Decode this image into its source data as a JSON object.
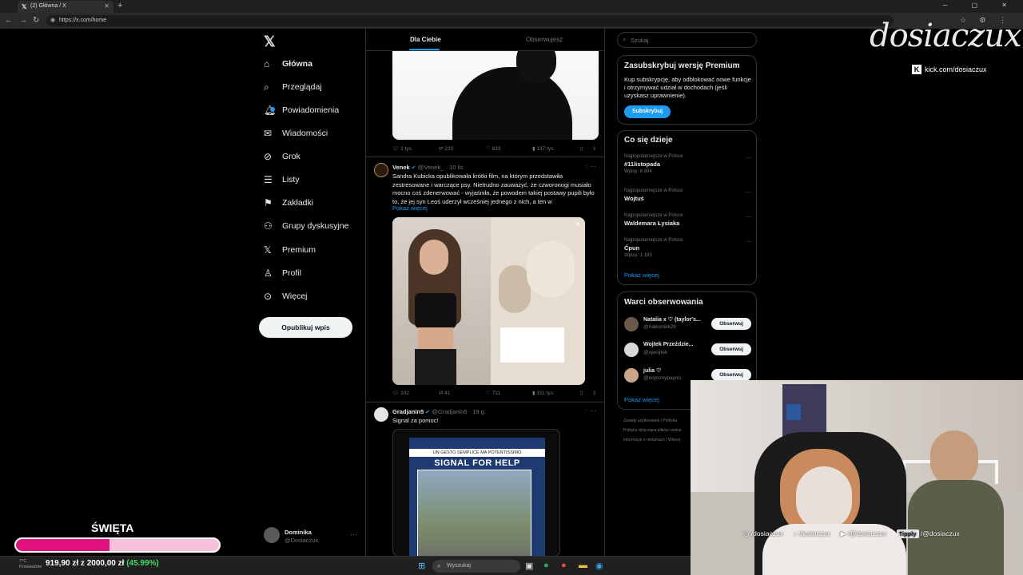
{
  "browser": {
    "tab_title": "(2) Główna / X",
    "tab_icon": "x-logo-icon",
    "url": "https://x.com/home"
  },
  "nav": {
    "items": [
      {
        "label": "Główna",
        "icon": "home-icon",
        "active": true
      },
      {
        "label": "Przeglądaj",
        "icon": "search-icon"
      },
      {
        "label": "Powiadomienia",
        "icon": "bell-icon"
      },
      {
        "label": "Wiadomości",
        "icon": "mail-icon"
      },
      {
        "label": "Grok",
        "icon": "grok-icon"
      },
      {
        "label": "Listy",
        "icon": "list-icon"
      },
      {
        "label": "Zakładki",
        "icon": "bookmark-icon"
      },
      {
        "label": "Grupy dyskusyjne",
        "icon": "communities-icon"
      },
      {
        "label": "Premium",
        "icon": "x-logo-icon"
      },
      {
        "label": "Profil",
        "icon": "profile-icon"
      },
      {
        "label": "Więcej",
        "icon": "more-circle-icon"
      }
    ],
    "post_button": "Opublikuj wpis",
    "account": {
      "name": "Dominika",
      "handle": "@Dosiaczux"
    }
  },
  "timeline": {
    "tabs": [
      "Dla Ciebie",
      "Obserwujesz"
    ],
    "tweets": [
      {
        "stats": {
          "replies": "1 tys.",
          "reposts": "220",
          "likes": "833",
          "views": "137 tys."
        }
      },
      {
        "name": "Venek",
        "handle": "@Venek_",
        "time": "· 10 lis",
        "text": "Sandra Kubicka opublikowała krótki film, na którym przedstawiła zestresowane i warczące psy. Nietrudno zauważyć, że czworonogi musiało mocno coś zdenerwować -  wyjaśniła, że powodem takiej postawy pupili było to, że jej syn Leoś uderzył wcześniej jednego z nich, a ten w",
        "show_more": "Pokaż więcej",
        "stats": {
          "replies": "102",
          "reposts": "41",
          "likes": "711",
          "views": "311 tys."
        }
      },
      {
        "name": "Gradjanin5",
        "handle": "@Gradjanin5",
        "time": "· 19 g.",
        "text": "Signal za pomoc!",
        "media_tag": "UN GESTO SEMPLICE MA POTENTISSIMO",
        "media_title": "SIGNAL FOR HELP"
      }
    ]
  },
  "sidebar": {
    "search_placeholder": "Szukaj",
    "premium": {
      "title": "Zasubskrybuj wersję Premium",
      "text": "Kup subskrypcję, aby odblokować nowe funkcje i otrzymywać udział w dochodach (jeśli uzyskasz uprawnienie).",
      "button": "Subskrybuj"
    },
    "trends": {
      "title": "Co się dzieje",
      "items": [
        {
          "context": "Najpopularniejsze w Polsce",
          "name": "#11listopada",
          "posts": "Wpisy: 8 904"
        },
        {
          "context": "Najpopularniejsze w Polsce",
          "name": "Wojtuś",
          "posts": ""
        },
        {
          "context": "Najpopularniejsze w Polsce",
          "name": "Waldemara Łysiaka",
          "posts": ""
        },
        {
          "context": "Najpopularniejsze w Polsce",
          "name": "Ćpun",
          "posts": "Wpisy: 1 193"
        }
      ],
      "show_more": "Pokaż więcej"
    },
    "who_to_follow": {
      "title": "Warci obserwowania",
      "items": [
        {
          "name": "Natalia x ♡ (taylor's...",
          "handle": "@nalesnikk29",
          "button": "Obserwuj"
        },
        {
          "name": "Wojtek Przeździe...",
          "handle": "@ojwojtek",
          "button": "Obserwuj"
        },
        {
          "name": "julia ♡",
          "handle": "@oopsmypayno",
          "button": "Obserwuj"
        }
      ],
      "show_more": "Pokaż więcej"
    },
    "footer": [
      "Zasady użytkowania",
      "Polityka",
      "Polityka dotycząca plików cookie",
      "Informacje o reklamach",
      "Więcej"
    ]
  },
  "overlay": {
    "brand": "dosiaczux",
    "kick_url": "kick.com/dosiaczux",
    "socials": [
      "/dosiaczux",
      "/dosiaczux",
      "/@dosiaczux"
    ],
    "tipply_label": "Tipply",
    "tipply_handle": "/@dosiaczux",
    "goal": {
      "label": "ŚWIĘTA",
      "amount_text": "919,90 zł z 2000,00 zł",
      "percent_text": "(45.99%)",
      "fraction": 0.4599,
      "fill_color": "#e0127d",
      "track_color": "#f7c1dc"
    }
  },
  "taskbar": {
    "search_placeholder": "Wyszukaj",
    "weather": [
      "7°C",
      "Przeważnie"
    ]
  }
}
